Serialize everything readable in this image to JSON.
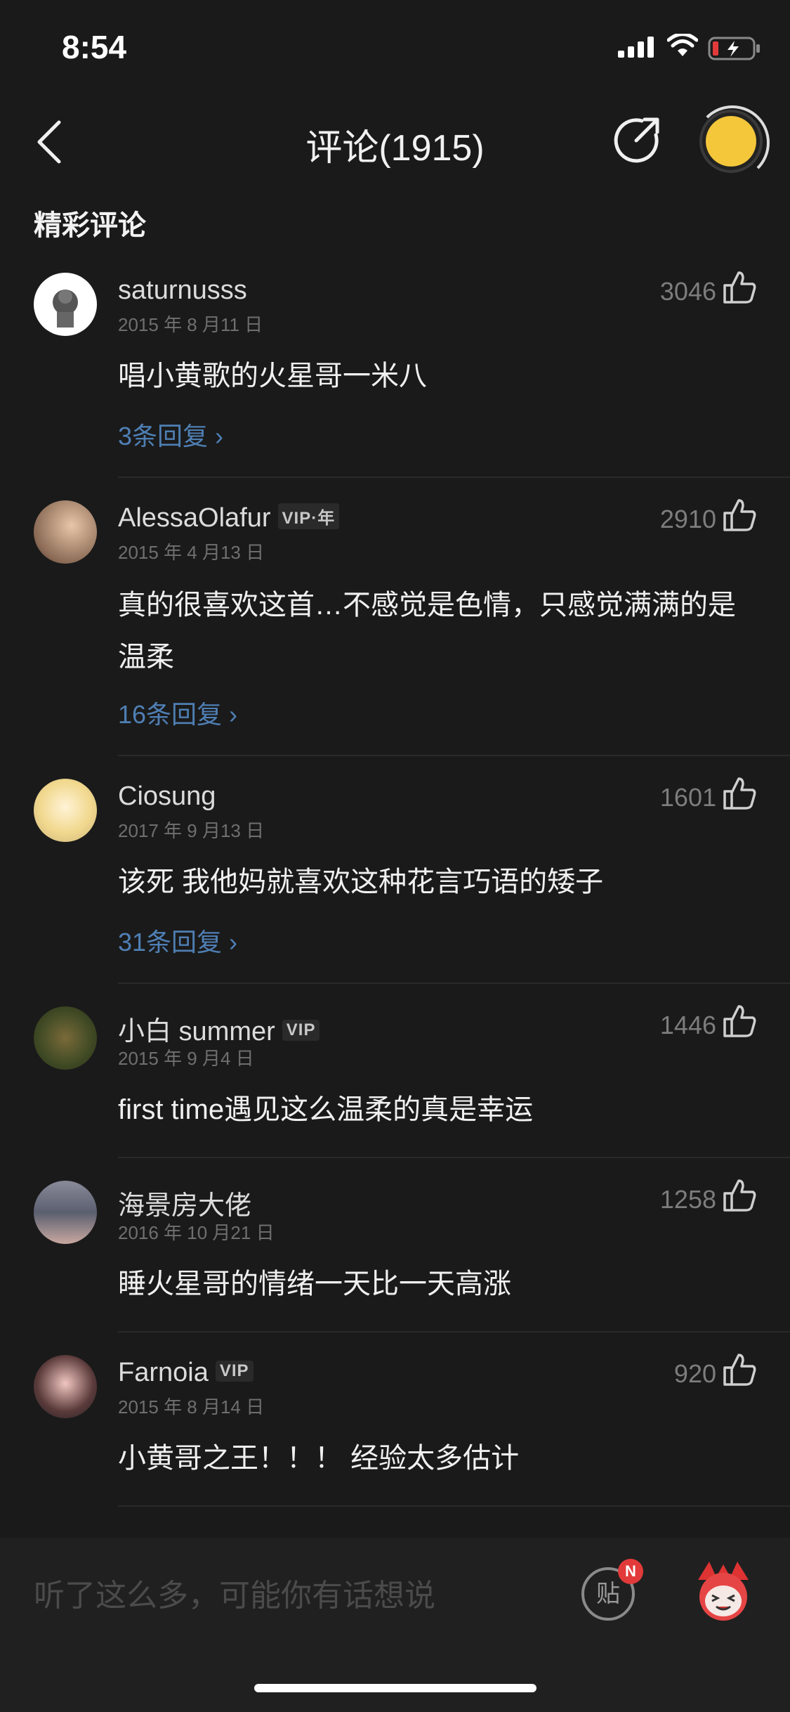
{
  "status": {
    "time": "8:54"
  },
  "nav": {
    "title": "评论(1915)"
  },
  "section_title": "精彩评论",
  "comments": [
    {
      "name": "saturnusss",
      "vip": "",
      "date": "2015 年 8 月11 日",
      "likes": "3046",
      "text": "唱小黄歌的火星哥一米八",
      "replies": "3条回复 ›"
    },
    {
      "name": "AlessaOlafur",
      "vip": "VIP·年",
      "date": "2015 年 4 月13 日",
      "likes": "2910",
      "text": "真的很喜欢这首…不感觉是色情，只感觉满满的是温柔",
      "replies": "16条回复 ›"
    },
    {
      "name": "Ciosung",
      "vip": "",
      "date": "2017 年 9 月13 日",
      "likes": "1601",
      "text": "该死 我他妈就喜欢这种花言巧语的矮子",
      "replies": "31条回复 ›"
    },
    {
      "name": "小白 summer",
      "vip": "VIP",
      "date": "2015 年 9 月4 日",
      "likes": "1446",
      "text": "first time遇见这么温柔的真是幸运",
      "replies": ""
    },
    {
      "name": "海景房大佬",
      "vip": "",
      "date": "2016 年 10 月21 日",
      "likes": "1258",
      "text": "睡火星哥的情绪一天比一天高涨",
      "replies": ""
    },
    {
      "name": "Farnoia",
      "vip": "VIP",
      "date": "2015 年 8 月14 日",
      "likes": "920",
      "text": "小黄哥之王！！！ 经验太多估计",
      "replies": ""
    }
  ],
  "bottom": {
    "placeholder": "听了这么多，可能你有话想说",
    "tie_label": "贴",
    "badge": "N"
  },
  "colors": {
    "background": "#1a1a1a",
    "reply_link": "#4f7fb4",
    "badge": "#e23a3a"
  }
}
